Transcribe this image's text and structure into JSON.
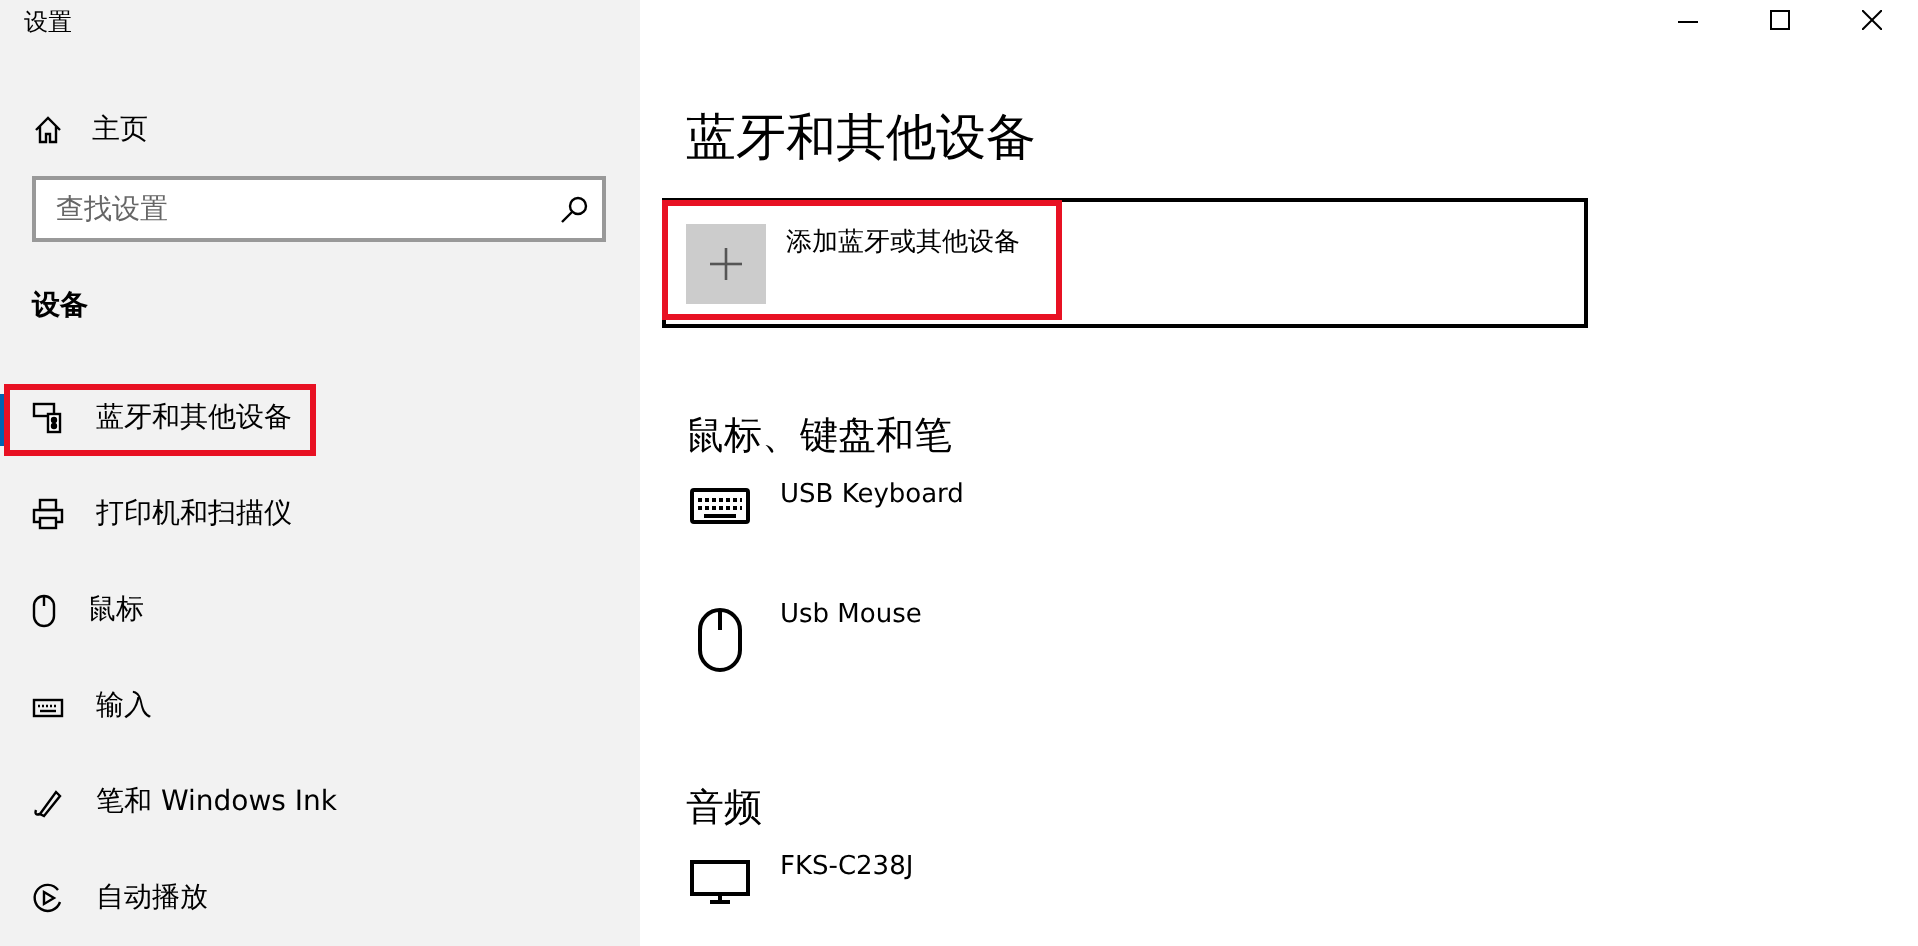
{
  "window": {
    "title": "设置",
    "controls": [
      {
        "kind": "minimize"
      },
      {
        "kind": "maximize"
      },
      {
        "kind": "close"
      }
    ]
  },
  "sidebar": {
    "home": {
      "label": "主页"
    },
    "search": {
      "placeholder": "查找设置"
    },
    "section": "设备",
    "items": [
      {
        "label": "蓝牙和其他设备",
        "kind": "bluetooth",
        "selected": true,
        "highlighted": true
      },
      {
        "label": "打印机和扫描仪",
        "kind": "printer",
        "selected": false,
        "highlighted": false
      },
      {
        "label": "鼠标",
        "kind": "mouse",
        "selected": false,
        "highlighted": false
      },
      {
        "label": "输入",
        "kind": "keyboard",
        "selected": false,
        "highlighted": false
      },
      {
        "label": "笔和 Windows Ink",
        "kind": "pen",
        "selected": false,
        "highlighted": false
      },
      {
        "label": "自动播放",
        "kind": "autoplay",
        "selected": false,
        "highlighted": false
      }
    ]
  },
  "main": {
    "title": "蓝牙和其他设备",
    "add_button": {
      "label": "添加蓝牙或其他设备",
      "highlighted": true
    },
    "groups": [
      {
        "title": "鼠标、键盘和笔",
        "devices": [
          {
            "name": "USB Keyboard",
            "kind": "keyboard"
          },
          {
            "name": "Usb Mouse",
            "kind": "mouse"
          }
        ]
      },
      {
        "title": "音频",
        "devices": [
          {
            "name": "FKS-C238J",
            "kind": "monitor"
          }
        ]
      }
    ]
  }
}
